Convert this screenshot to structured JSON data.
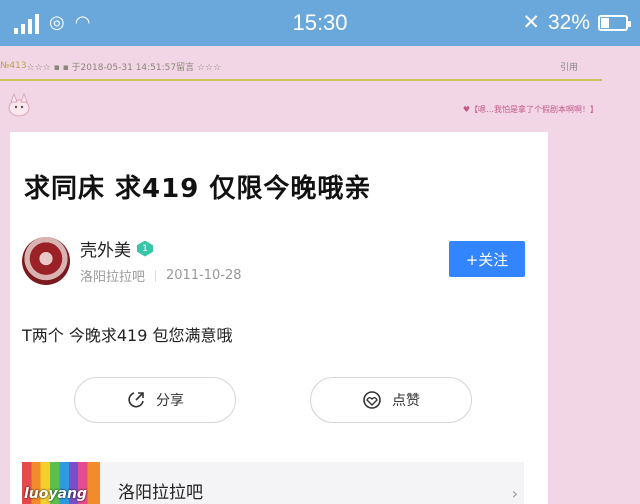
{
  "status_bar": {
    "time": "15:30",
    "battery": "32%",
    "battery_fraction": 0.32
  },
  "forum_bg": {
    "meta_index": "№413",
    "meta_text": "☆☆☆ ▪ ▪ 于2018-05-31 14:51:57留言 ☆☆☆",
    "reply_label": "引用",
    "signature": "♥【嗯…我怕是拿了个假剧本啊啊！】"
  },
  "post": {
    "title": "求同床 求419 仅限今晚哦亲",
    "author": "壳外美",
    "badge": "1",
    "forum": "洛阳拉拉吧",
    "date": "2011-10-28",
    "follow_label": "+关注",
    "body": "T两个 今晚求419 包您满意哦",
    "share_label": "分享",
    "like_label": "点赞"
  },
  "forum_bar": {
    "logo_text": "luoyang",
    "name": "洛阳拉拉吧",
    "chevron": "›"
  },
  "icons": [
    "signal-icon",
    "network-icon",
    "wifi-icon",
    "mute-icon",
    "battery-icon",
    "share-icon",
    "like-icon",
    "chevron-right-icon"
  ]
}
